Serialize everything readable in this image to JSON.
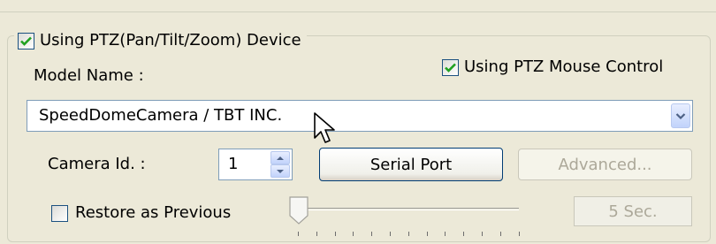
{
  "ptz_group": {
    "use_ptz_checked": true,
    "use_ptz_label": "Using PTZ(Pan/Tilt/Zoom) Device",
    "model_name_label": "Model Name :",
    "mouse_control_checked": true,
    "mouse_control_label": "Using PTZ Mouse Control",
    "model_selected": "SpeedDomeCamera / TBT INC.",
    "camera_id_label": "Camera Id. :",
    "camera_id_value": "1",
    "serial_port_label": "Serial Port",
    "advanced_label": "Advanced...",
    "restore_checked": false,
    "restore_label": "Restore as Previous",
    "delay_value_text": "5 Sec.",
    "delay_slider_level": 0
  },
  "colors": {
    "background": "#ece9d8",
    "check_mark": "#21a121",
    "xp_blue_border": "#1c5180",
    "disabled_text": "#aca899"
  },
  "icons": {
    "check": "check-icon",
    "dropdown": "chevron-down-icon",
    "spin_up": "arrow-up-icon",
    "spin_down": "arrow-down-icon",
    "cursor": "mouse-pointer-icon",
    "slider_thumb": "slider-thumb-icon"
  }
}
